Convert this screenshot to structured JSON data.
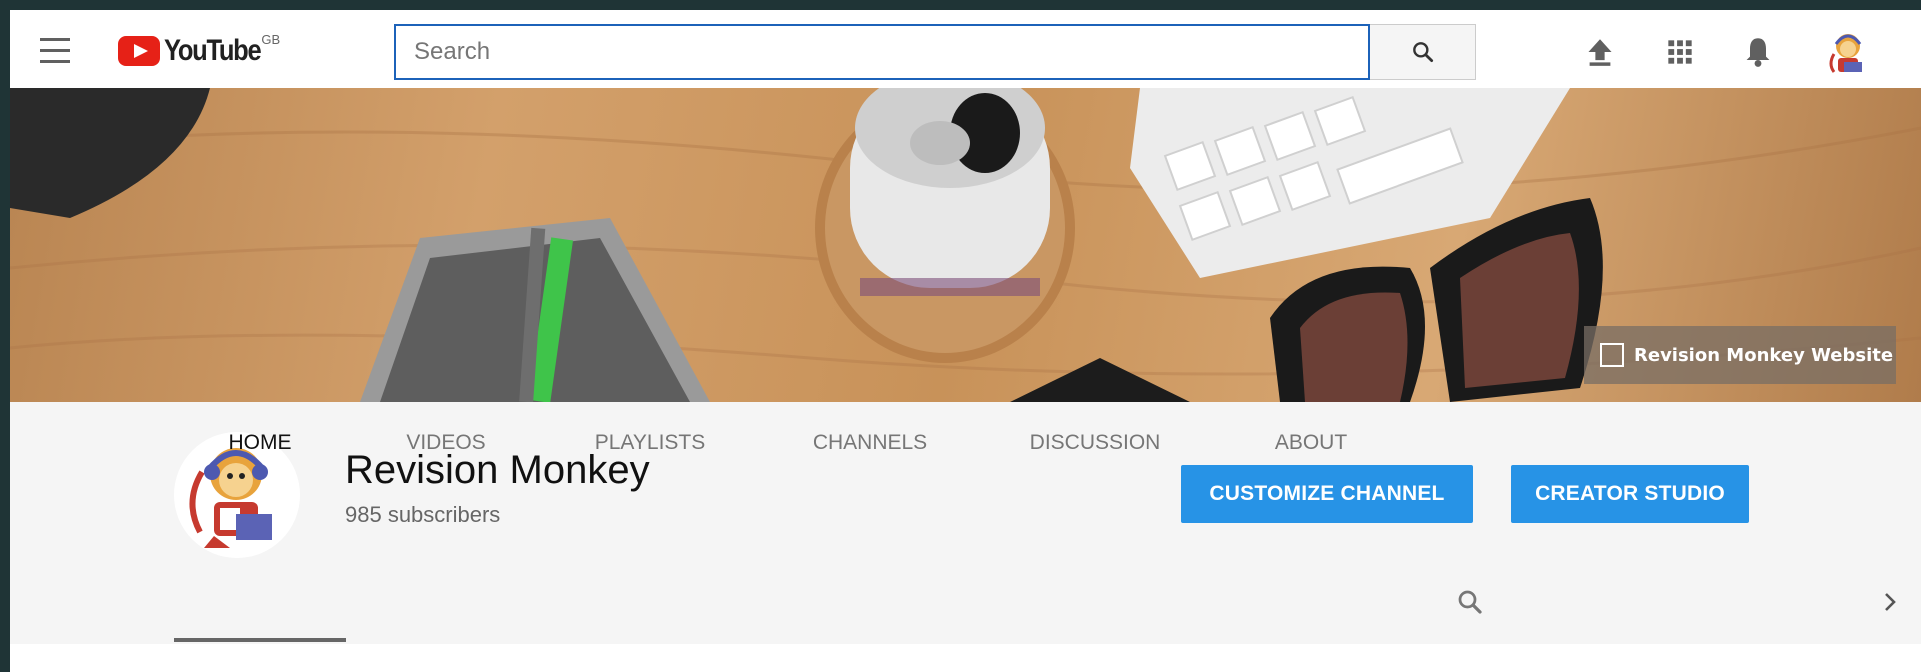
{
  "masthead": {
    "logo_text": "YouTube",
    "region": "GB",
    "search_placeholder": "Search",
    "icons": [
      "menu-icon",
      "upload-icon",
      "apps-icon",
      "bell-icon"
    ]
  },
  "banner": {
    "link_label": "Revision Monkey Website"
  },
  "channel": {
    "name": "Revision Monkey",
    "subscribers": "985 subscribers",
    "customize_label": "CUSTOMIZE CHANNEL",
    "studio_label": "CREATOR STUDIO"
  },
  "tabs": [
    {
      "label": "HOME",
      "active": true
    },
    {
      "label": "VIDEOS"
    },
    {
      "label": "PLAYLISTS"
    },
    {
      "label": "CHANNELS"
    },
    {
      "label": "DISCUSSION"
    },
    {
      "label": "ABOUT"
    }
  ],
  "colors": {
    "accent_blue": "#2793e6",
    "youtube_red": "#e62117",
    "search_border": "#1c62b9"
  }
}
